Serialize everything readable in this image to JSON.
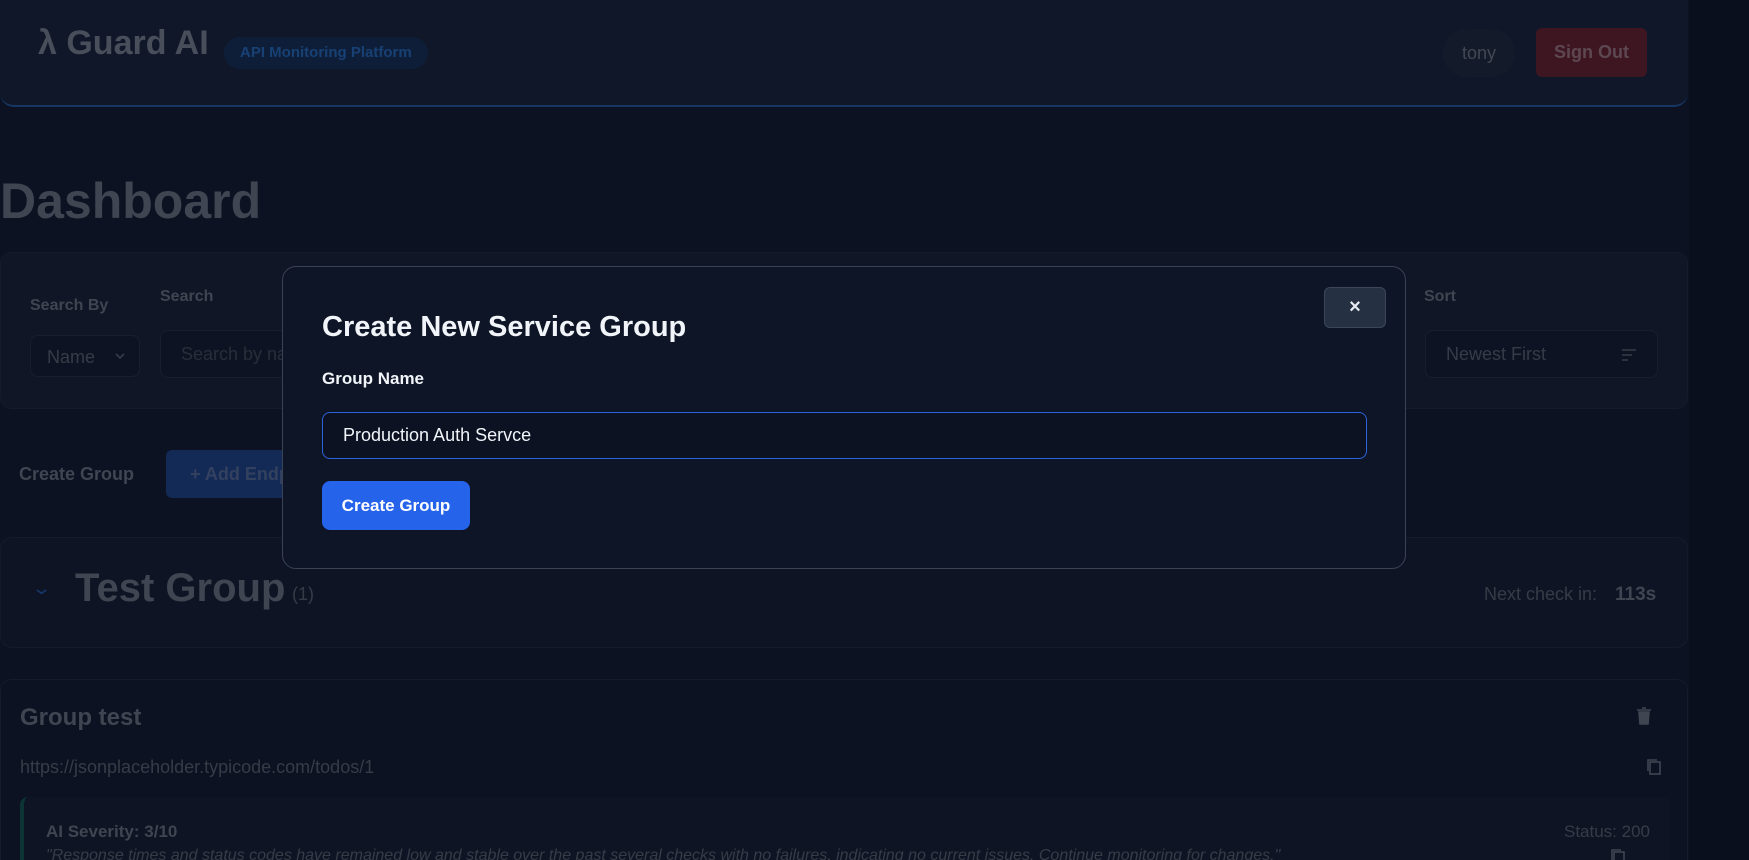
{
  "header": {
    "logo": "λ Guard AI",
    "platform_badge": "API Monitoring Platform",
    "user": "tony",
    "signout_label": "Sign Out"
  },
  "dashboard": {
    "title": "Dashboard",
    "filters": {
      "search_by_label": "Search By",
      "search_by_value": "Name",
      "search_label": "Search",
      "search_placeholder": "Search by na",
      "sort_label": "Sort",
      "sort_value": "Newest First"
    },
    "create_group_label": "Create Group",
    "add_endpoint_label": "+ Add Endp"
  },
  "group": {
    "title": "Test Group",
    "count": "(1)",
    "next_check_label": "Next check in:",
    "next_check_value": "113s"
  },
  "endpoint": {
    "name": "Group test",
    "url": "https://jsonplaceholder.typicode.com/todos/1",
    "severity_title": "AI Severity: 3/10",
    "status": "Status: 200",
    "summary": "\"Response times and status codes have remained low and stable over the past several checks with no failures, indicating no current issues. Continue monitoring for changes.\""
  },
  "modal": {
    "title": "Create New Service Group",
    "close_label": "×",
    "field_label": "Group Name",
    "input_value": "Production Auth Servce",
    "submit_label": "Create Group"
  },
  "colors": {
    "background": "#0f1629",
    "accent": "#2563eb",
    "danger": "#5a1c28"
  },
  "icons": [
    "chevron-down-icon",
    "sort-icon",
    "trash-icon",
    "copy-icon",
    "close-icon"
  ]
}
